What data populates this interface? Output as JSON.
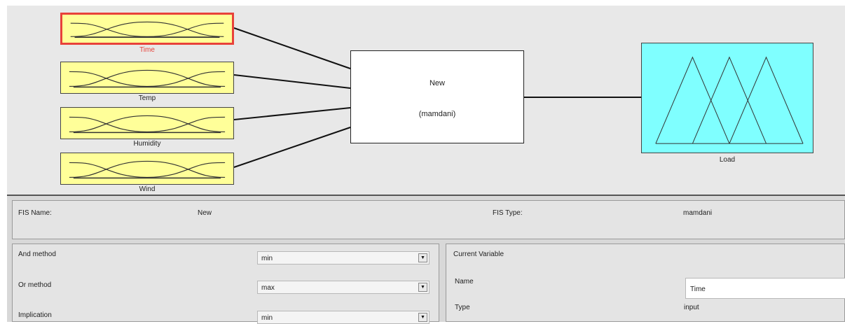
{
  "diagram": {
    "inputs": [
      {
        "name": "Time",
        "selected": true
      },
      {
        "name": "Temp",
        "selected": false
      },
      {
        "name": "Humidity",
        "selected": false
      },
      {
        "name": "Wind",
        "selected": false
      }
    ],
    "fis": {
      "name": "New",
      "type": "(mamdani)"
    },
    "output": {
      "name": "Load"
    },
    "colors": {
      "input_fill": "#ffff99",
      "output_fill": "#7fffff",
      "selected_border": "#e8423a"
    }
  },
  "fis_info": {
    "name_label": "FIS Name:",
    "name_value": "New",
    "type_label": "FIS Type:",
    "type_value": "mamdani"
  },
  "methods": [
    {
      "label": "And method",
      "value": "min"
    },
    {
      "label": "Or method",
      "value": "max"
    },
    {
      "label": "Implication",
      "value": "min"
    }
  ],
  "current_variable": {
    "title": "Current Variable",
    "name_label": "Name",
    "name_value": "Time",
    "type_label": "Type",
    "type_value": "input"
  },
  "icons": {
    "dropdown": "chevron-down-icon"
  }
}
